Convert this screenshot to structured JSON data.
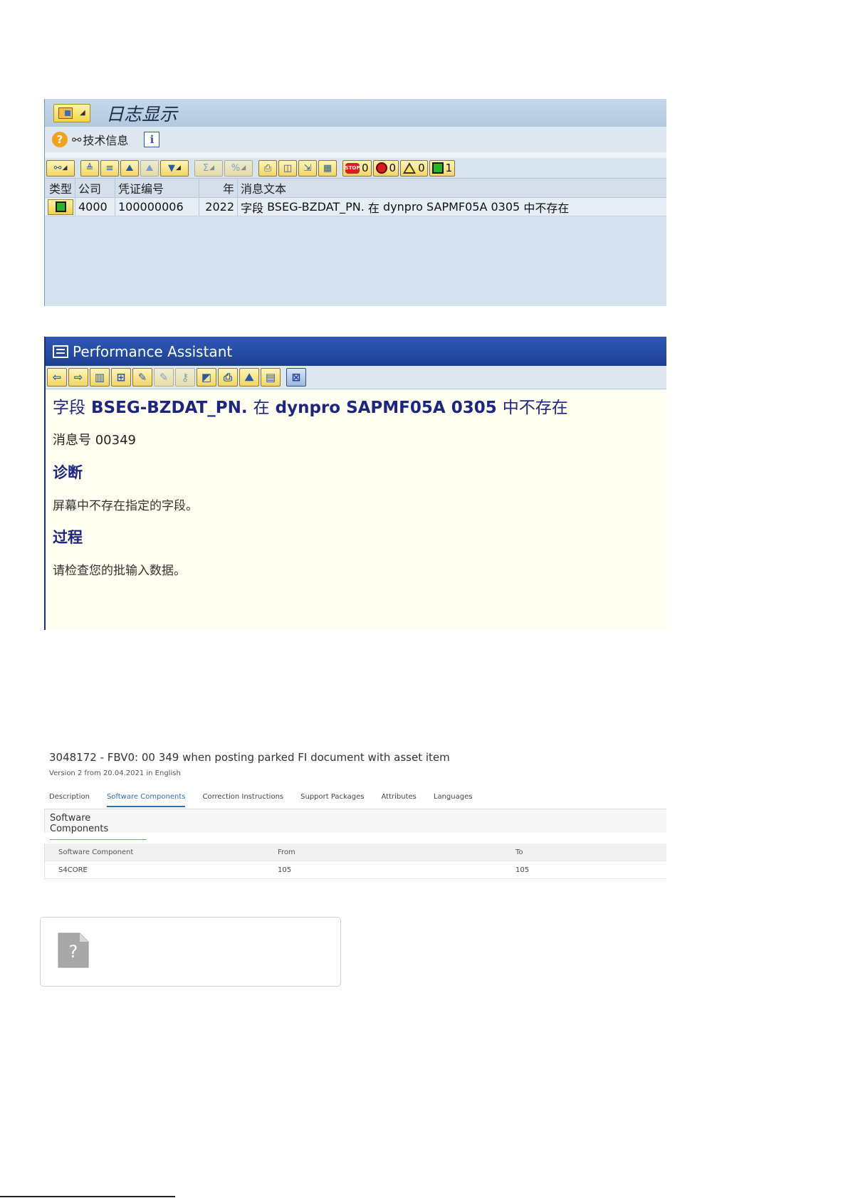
{
  "log_panel": {
    "title": "日志显示",
    "tech_info_label": "技术信息",
    "counters": {
      "stop": "0",
      "error": "0",
      "warning": "0",
      "ok": "1"
    },
    "columns": {
      "type": "类型",
      "company": "公司",
      "doc_no": "凭证编号",
      "year": "年",
      "message": "消息文本"
    },
    "row": {
      "status": "success",
      "company": "4000",
      "doc_no": "100000006",
      "year": "2022",
      "message_prefix": "字段",
      "message_field": "BSEG-BZDAT_PN.",
      "message_in": "在",
      "message_dynpro": "dynpro SAPMF05A 0305",
      "message_suffix": "中不存在"
    }
  },
  "performance_assistant": {
    "title": "Performance Assistant",
    "heading_prefix": "字段",
    "heading_field": "BSEG-BZDAT_PN.",
    "heading_in": "在",
    "heading_dynpro": "dynpro SAPMF05A 0305",
    "heading_suffix": "中不存在",
    "message_no_label": "消息号",
    "message_no": "00349",
    "diagnosis_title": "诊断",
    "diagnosis_text": "屏幕中不存在指定的字段。",
    "procedure_title": "过程",
    "procedure_text": "请检查您的批输入数据。"
  },
  "sap_note": {
    "title": "3048172 - FBV0: 00 349 when posting parked FI document with asset item",
    "version": "Version 2 from 20.04.2021 in English",
    "tabs": [
      {
        "label": "Description",
        "active": false
      },
      {
        "label": "Software Components",
        "active": true
      },
      {
        "label": "Correction Instructions",
        "active": false
      },
      {
        "label": "Support Packages",
        "active": false
      },
      {
        "label": "Attributes",
        "active": false
      },
      {
        "label": "Languages",
        "active": false
      }
    ],
    "section_title": "Software Components",
    "table": {
      "headers": [
        "Software Component",
        "From",
        "To"
      ],
      "rows": [
        [
          "S4CORE",
          "105",
          "105"
        ]
      ]
    }
  },
  "placeholder": {
    "icon": "missing-file-icon",
    "glyph": "?"
  },
  "colors": {
    "sap_blue": "#1d3f93",
    "note_accent": "#2e6bb3",
    "pa_background": "#fffef0",
    "ok_green": "#2bb42b"
  }
}
